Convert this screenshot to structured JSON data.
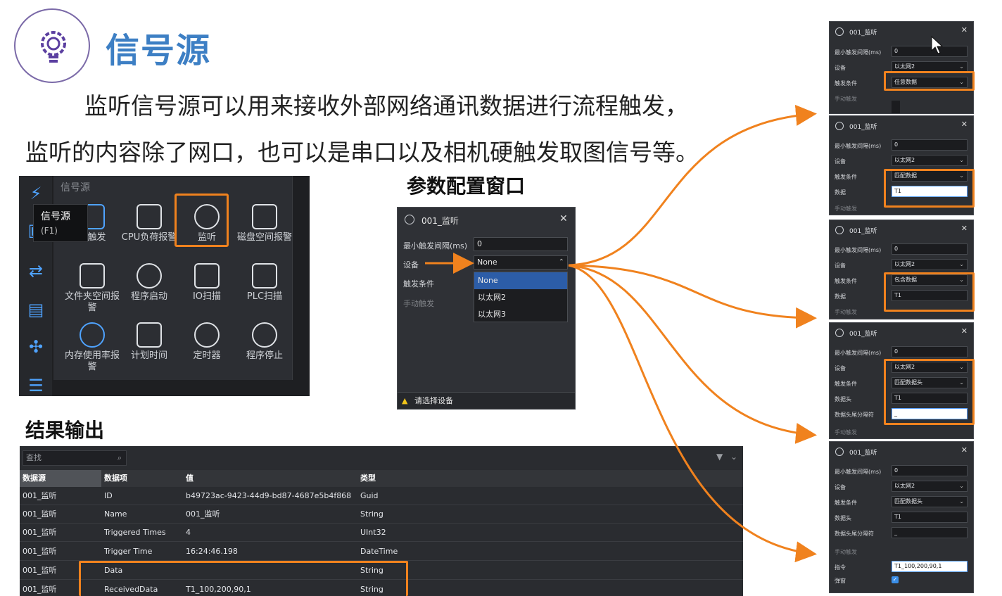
{
  "header": {
    "title": "信号源",
    "intro_line_1": "监听信号源可以用来接收外部网络通讯数据进行流程触发，",
    "intro_line_2": "监听的内容除了网口，也可以是串口以及相机硬触发取图信号等。"
  },
  "palette": {
    "header": "信号源",
    "tooltip_title": "信号源",
    "tooltip_key": "(F1)",
    "items": [
      {
        "label": "部触发",
        "icon": "monitor-icon"
      },
      {
        "label": "CPU负荷报警",
        "icon": "cpu-chart-icon"
      },
      {
        "label": "监听",
        "icon": "satellite-dish-icon"
      },
      {
        "label": "磁盘空间报警",
        "icon": "disk-alert-icon"
      },
      {
        "label": "文件夹空间报警",
        "icon": "folder-alert-icon"
      },
      {
        "label": "程序启动",
        "icon": "play-icon"
      },
      {
        "label": "IO扫描",
        "icon": "io-scan-icon"
      },
      {
        "label": "PLC扫描",
        "icon": "plc-scan-icon"
      },
      {
        "label": "内存使用率报警",
        "icon": "memory-pie-icon"
      },
      {
        "label": "计划时间",
        "icon": "calendar-icon"
      },
      {
        "label": "定时器",
        "icon": "timer-icon"
      },
      {
        "label": "程序停止",
        "icon": "power-icon"
      }
    ]
  },
  "config": {
    "caption": "参数配置窗口",
    "title": "001_监听",
    "close": "✕",
    "min_interval_label": "最小触发间隔(ms)",
    "min_interval_value": "0",
    "device_label": "设备",
    "device_value": "None",
    "trigger_label": "触发条件",
    "manual_trigger": "手动触发",
    "options": [
      "None",
      "以太网2",
      "以太网3"
    ],
    "status": "请选择设备"
  },
  "result": {
    "caption": "结果输出",
    "search_placeholder": "查找",
    "columns": [
      "数据源",
      "数据项",
      "值",
      "类型"
    ],
    "rows": [
      [
        "001_监听",
        "ID",
        "b49723ac-9423-44d9-bd87-4687e5b4f868",
        "Guid"
      ],
      [
        "001_监听",
        "Name",
        "001_监听",
        "String"
      ],
      [
        "001_监听",
        "Triggered Times",
        "4",
        "UInt32"
      ],
      [
        "001_监听",
        "Trigger Time",
        "16:24:46.198",
        "DateTime"
      ],
      [
        "001_监听",
        "Data",
        "",
        "String"
      ],
      [
        "001_监听",
        "ReceivedData",
        "T1_100,200,90,1",
        "String"
      ]
    ]
  },
  "right_panels": [
    {
      "title": "001_监听",
      "fields": [
        {
          "label": "最小触发间隔(ms)",
          "value": "0",
          "select": false
        },
        {
          "label": "设备",
          "value": "以太网2",
          "select": true
        },
        {
          "label": "触发条件",
          "value": "任意数据",
          "select": true
        }
      ],
      "manual": "手动触发"
    },
    {
      "title": "001_监听",
      "fields": [
        {
          "label": "最小触发间隔(ms)",
          "value": "0",
          "select": false
        },
        {
          "label": "设备",
          "value": "以太网2",
          "select": true
        },
        {
          "label": "触发条件",
          "value": "匹配数据",
          "select": true
        },
        {
          "label": "数据",
          "value": "T1",
          "select": false
        }
      ],
      "manual": "手动触发"
    },
    {
      "title": "001_监听",
      "fields": [
        {
          "label": "最小触发间隔(ms)",
          "value": "0",
          "select": false
        },
        {
          "label": "设备",
          "value": "以太网2",
          "select": true
        },
        {
          "label": "触发条件",
          "value": "包含数据",
          "select": true
        },
        {
          "label": "数据",
          "value": "T1",
          "select": false
        }
      ],
      "manual": "手动触发"
    },
    {
      "title": "001_监听",
      "fields": [
        {
          "label": "最小触发间隔(ms)",
          "value": "0",
          "select": false
        },
        {
          "label": "设备",
          "value": "以太网2",
          "select": true
        },
        {
          "label": "触发条件",
          "value": "匹配数据头",
          "select": true
        },
        {
          "label": "数据头",
          "value": "T1",
          "select": false
        },
        {
          "label": "数据头尾分隔符",
          "value": "_",
          "select": false
        }
      ],
      "manual": "手动触发"
    },
    {
      "title": "001_监听",
      "fields": [
        {
          "label": "最小触发间隔(ms)",
          "value": "0",
          "select": false
        },
        {
          "label": "设备",
          "value": "以太网2",
          "select": true
        },
        {
          "label": "触发条件",
          "value": "匹配数据头",
          "select": true
        },
        {
          "label": "数据头",
          "value": "T1",
          "select": false
        },
        {
          "label": "数据头尾分隔符",
          "value": "_",
          "select": false
        }
      ],
      "manual": "手动触发",
      "command_label": "指令",
      "command_value": "T1_100,200,90,1",
      "popup_label": "弹窗"
    }
  ],
  "colors": {
    "accent_orange": "#f0821e",
    "title_blue": "#3d7fc4",
    "panel_dark": "#2d2f33"
  }
}
